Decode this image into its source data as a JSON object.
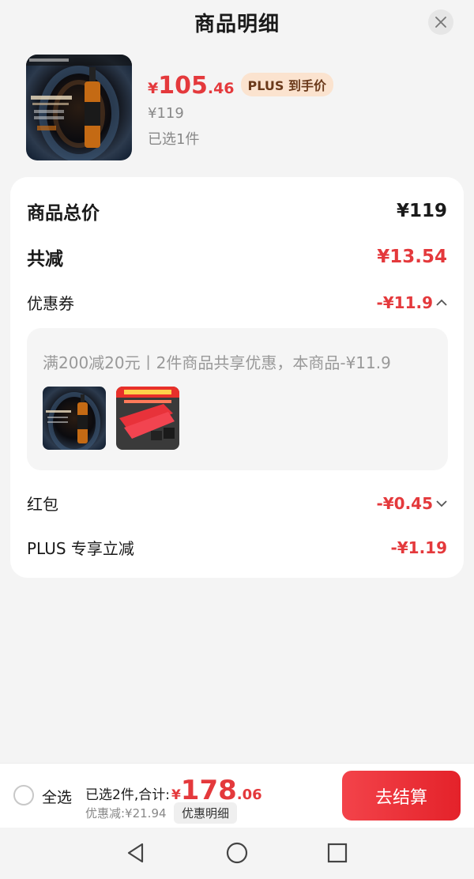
{
  "header": {
    "title": "商品明细"
  },
  "product": {
    "price_symbol": "¥",
    "price_integer": "105",
    "price_decimal": ".46",
    "plus_badge": "PLUS 到手价",
    "original_price": "¥119",
    "selected_count": "已选1件"
  },
  "summary": {
    "total_label": "商品总价",
    "total_value": "¥119",
    "reduce_label": "共减",
    "reduce_value": "¥13.54",
    "coupon_label": "优惠券",
    "coupon_value": "-¥11.9",
    "coupon_detail": "满200减20元丨2件商品共享优惠，本商品-¥11.9",
    "redpacket_label": "红包",
    "redpacket_value": "-¥0.45",
    "plus_label": "PLUS 专享立减",
    "plus_value": "-¥1.19"
  },
  "bottom": {
    "select_all": "全选",
    "selected_total_label": "已选2件,合计:",
    "total_symbol": "¥",
    "total_integer": "178",
    "total_decimal": ".06",
    "discount_text": "优惠减:¥21.94",
    "discount_detail": "优惠明细",
    "checkout": "去结算"
  },
  "colors": {
    "accent_red": "#e4393c",
    "plus_badge_bg": "#fbe3cf",
    "page_bg": "#f4f4f4"
  }
}
